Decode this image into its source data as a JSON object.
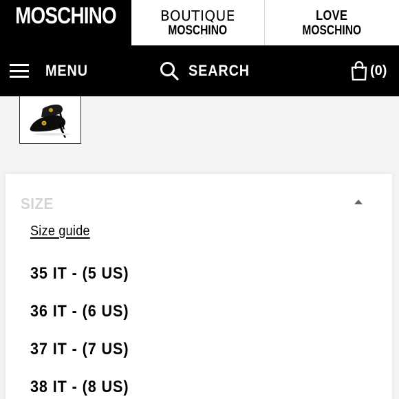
{
  "brands": [
    {
      "line1": "MOSCHINO",
      "line2": ""
    },
    {
      "line1": "BOUTIQUE",
      "line2": "MOSCHINO"
    },
    {
      "line1": "LOVE",
      "line2": "MOSCHINO"
    }
  ],
  "nav": {
    "menu_label": "MENU",
    "search_label": "SEARCH",
    "cart_count": "(0)"
  },
  "product": {
    "thumbnail_icon": "black-pump-shoe"
  },
  "size_panel": {
    "title": "SIZE",
    "size_guide_label": "Size guide",
    "options": [
      "35 IT - (5 US)",
      "36 IT - (6 US)",
      "37 IT - (7 US)",
      "38 IT - (8 US)"
    ]
  }
}
